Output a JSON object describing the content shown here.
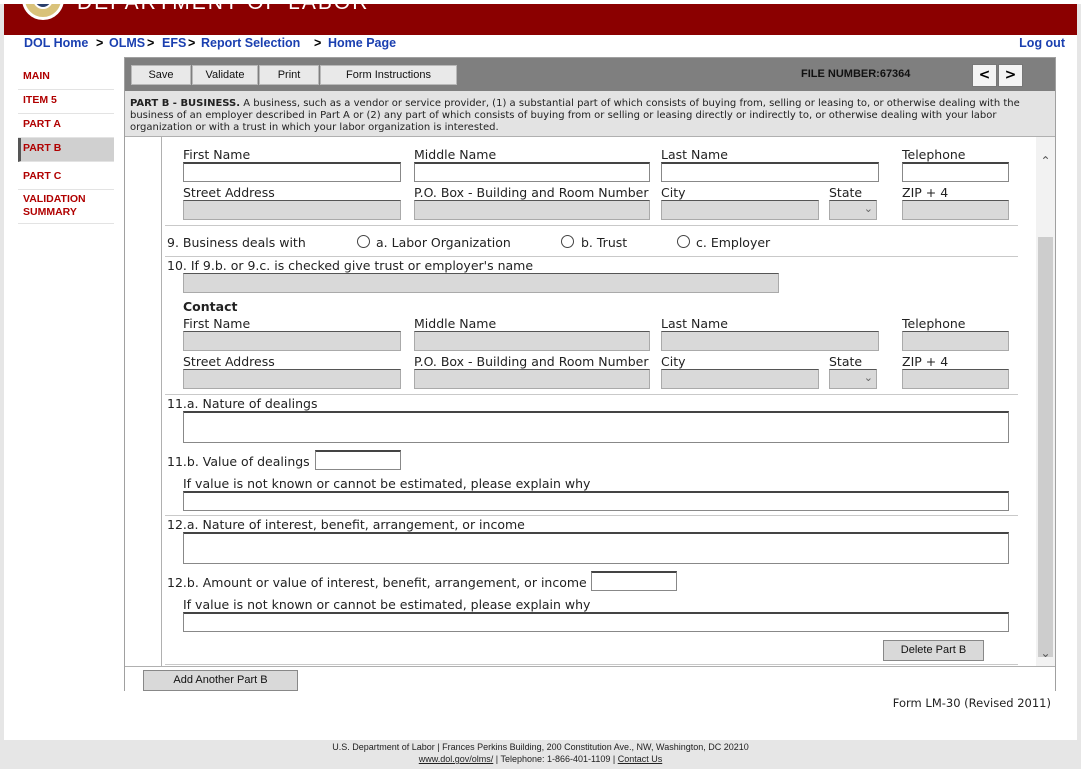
{
  "banner": {
    "title": "DEPARTMENT OF LABOR"
  },
  "breadcrumb": {
    "items": [
      "DOL Home",
      "OLMS",
      "EFS",
      "Report Selection",
      "Home Page"
    ],
    "separators": [
      ">",
      ">",
      ">",
      ">"
    ],
    "logout": "Log out"
  },
  "sidebar": {
    "items": [
      {
        "label": "MAIN"
      },
      {
        "label": "ITEM 5"
      },
      {
        "label": "PART A"
      },
      {
        "label": "PART B"
      },
      {
        "label": "PART C"
      },
      {
        "label": "VALIDATION SUMMARY"
      }
    ]
  },
  "toolbar": {
    "save": "Save",
    "validate": "Validate",
    "print": "Print",
    "instructions": "Form Instructions",
    "file_number": "FILE NUMBER:67364",
    "prev": "<",
    "next": ">"
  },
  "description": {
    "heading": "PART B - BUSINESS.",
    "text": " A business, such as a vendor or service provider, (1) a substantial part of which consists of buying from, selling or leasing to, or otherwise dealing with the business of an employer described in Part A or (2) any part of which consists of buying from or selling or leasing directly or indirectly to, or otherwise dealing with your labor organization or with a trust in which your labor organization is interested."
  },
  "form": {
    "contact1": {
      "first_name": "First Name",
      "middle_name": "Middle Name",
      "last_name": "Last Name",
      "telephone": "Telephone",
      "street": "Street Address",
      "pobox": "P.O. Box - Building and Room Number",
      "city": "City",
      "state": "State",
      "zip": "ZIP + 4"
    },
    "q9": {
      "label": "9. Business deals with",
      "opt_a": "a. Labor Organization",
      "opt_b": "b. Trust",
      "opt_c": "c. Employer"
    },
    "q10": {
      "label": "10. If 9.b. or 9.c. is checked give trust or employer's name"
    },
    "contact2": {
      "heading": "Contact",
      "first_name": "First Name",
      "middle_name": "Middle Name",
      "last_name": "Last Name",
      "telephone": "Telephone",
      "street": "Street Address",
      "pobox": "P.O. Box - Building and Room Number",
      "city": "City",
      "state": "State",
      "zip": "ZIP + 4"
    },
    "q11a": "11.a. Nature of dealings",
    "q11b": "11.b. Value of dealings",
    "q11b_explain": "If value is not known or cannot be estimated, please explain why",
    "q12a": "12.a. Nature of interest, benefit, arrangement, or income",
    "q12b": "12.b. Amount or value of interest, benefit, arrangement, or income",
    "q12b_explain": "If value is not known or cannot be estimated, please explain why",
    "delete_part": "Delete Part B",
    "add_part": "Add Another Part B"
  },
  "form_revision": "Form LM-30 (Revised 2011)",
  "footer": {
    "line1": "U.S. Department of Labor | Frances Perkins Building, 200 Constitution Ave., NW, Washington, DC 20210",
    "link1": "www.dol.gov/olms/",
    "phone": " | Telephone: 1-866-401-1109 | ",
    "link2": "Contact Us"
  }
}
